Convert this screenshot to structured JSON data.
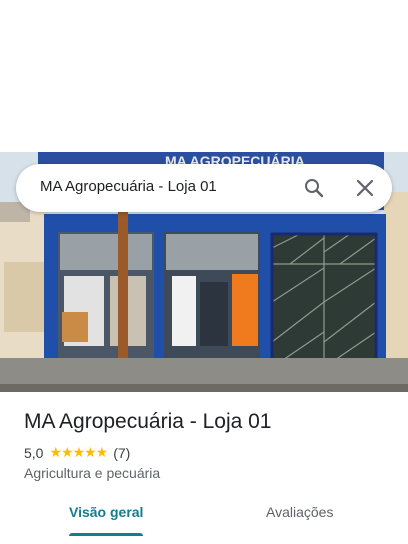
{
  "search": {
    "query": "MA Agropecuária - Loja 01"
  },
  "photo": {
    "sign_text": "MA AGROPECUÁRIA"
  },
  "place": {
    "name": "MA Agropecuária - Loja 01",
    "rating": "5,0",
    "stars": "★★★★★",
    "review_count": "(7)",
    "category": "Agricultura e pecuária"
  },
  "tabs": [
    {
      "label": "Visão geral"
    },
    {
      "label": "Avaliações"
    }
  ],
  "colors": {
    "accent": "#137d8e",
    "star": "#fbbc04",
    "storefront_blue": "#1f4fa8"
  },
  "icons": {
    "search": "search-icon",
    "close": "close-icon"
  }
}
